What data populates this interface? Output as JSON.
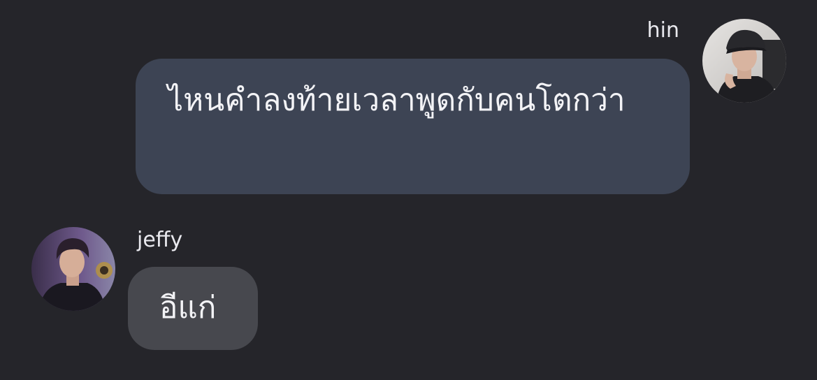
{
  "chat": {
    "messages": [
      {
        "sender": "hin",
        "avatar_icon": "profile-photo-man-with-black-cap",
        "text": "ไหนคำลงท้ายเวลาพูดกับคนโตกว่า",
        "bubble_color": "#3d4454"
      },
      {
        "sender": "jeffy",
        "avatar_icon": "profile-photo-man-in-dark-hoodie",
        "text": "อีแก่",
        "bubble_color": "#47484e"
      }
    ]
  },
  "colors": {
    "background": "#25252a",
    "text": "#f3f3f6"
  }
}
